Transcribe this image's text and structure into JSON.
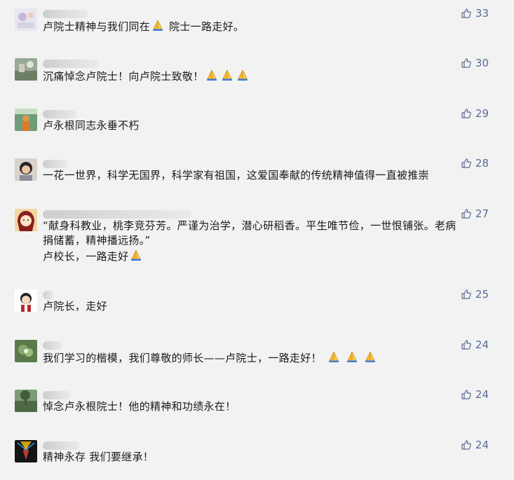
{
  "comments": [
    {
      "text_parts": [
        "卢院士精神与我们同在",
        "[pray-icon]",
        " 院士一路走好。"
      ],
      "likes": "33"
    },
    {
      "text_parts": [
        "沉痛悼念卢院士！向卢院士致敬！",
        "[pray-icon]",
        "[pray-icon]",
        "[pray-icon]"
      ],
      "likes": "30"
    },
    {
      "text": "卢永根同志永垂不朽",
      "likes": "29"
    },
    {
      "text": "一花一世界，科学无国界，科学家有祖国，这爱国奉献的传统精神值得一直被推崇",
      "likes": "28"
    },
    {
      "lines": [
        "“献身科教业，桃李竞芬芳。严谨为治学，潜心研稻香。平生唯节俭，一世恨铺张。老病",
        "捐储蓄，精神播远扬。”"
      ],
      "last_line": "卢校长，一路走好",
      "likes": "27"
    },
    {
      "text": "卢院长，走好",
      "likes": "25"
    },
    {
      "text": "我们学习的楷模，我们尊敬的师长——卢院士，一路走好！",
      "likes": "24"
    },
    {
      "text": "悼念卢永根院士！他的精神和功绩永在！",
      "likes": "24"
    },
    {
      "text": "精神永存 我们要继承！",
      "likes": "24"
    }
  ],
  "like_color": "#576b95",
  "icons": {
    "like": "thumbs-up-icon",
    "emoji": "pray-icon"
  }
}
